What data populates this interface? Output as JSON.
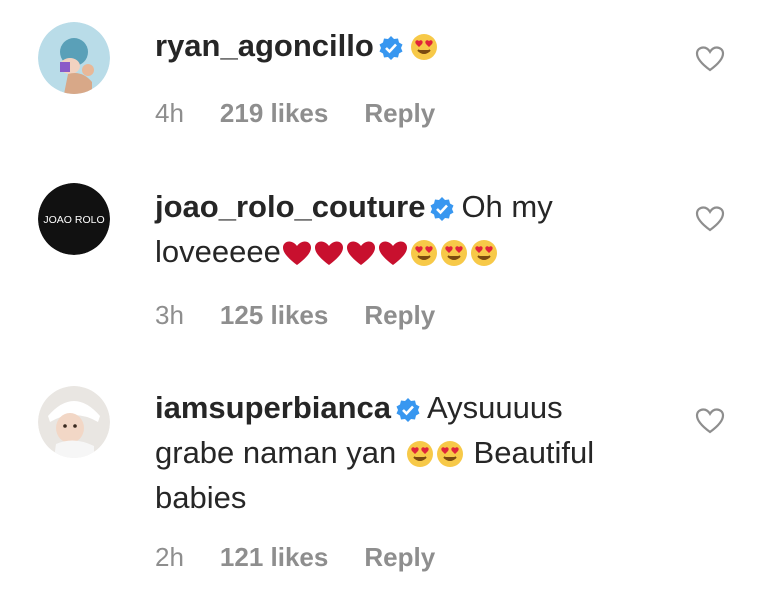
{
  "comments": [
    {
      "username": "ryan_agoncillo",
      "verified": true,
      "text_line1": "",
      "text_line2": "",
      "text_line3": "",
      "emojis": [
        "heart-eyes-emoji"
      ],
      "time": "4h",
      "likes": "219 likes",
      "reply": "Reply"
    },
    {
      "username": "joao_rolo_couture",
      "verified": true,
      "text_line1": "Oh my",
      "text_line2": "loveeeee",
      "emojis": [
        "red-heart-emoji",
        "red-heart-emoji",
        "red-heart-emoji",
        "red-heart-emoji",
        "heart-eyes-emoji",
        "heart-eyes-emoji",
        "heart-eyes-emoji"
      ],
      "avatar_text": "JOAO ROLO",
      "time": "3h",
      "likes": "125 likes",
      "reply": "Reply"
    },
    {
      "username": "iamsuperbianca",
      "verified": true,
      "text_line1": "Aysuuuus",
      "text_line2a": "grabe naman yan",
      "text_line2b": "Beautiful",
      "text_line3": "babies",
      "emojis": [
        "heart-eyes-emoji",
        "heart-eyes-emoji"
      ],
      "time": "2h",
      "likes": "121 likes",
      "reply": "Reply"
    }
  ],
  "colors": {
    "verified": "#3897f0",
    "meta": "#8e8e8e",
    "text": "#262626",
    "heart_red": "#c8102e",
    "emoji_yellow": "#f7c948"
  }
}
